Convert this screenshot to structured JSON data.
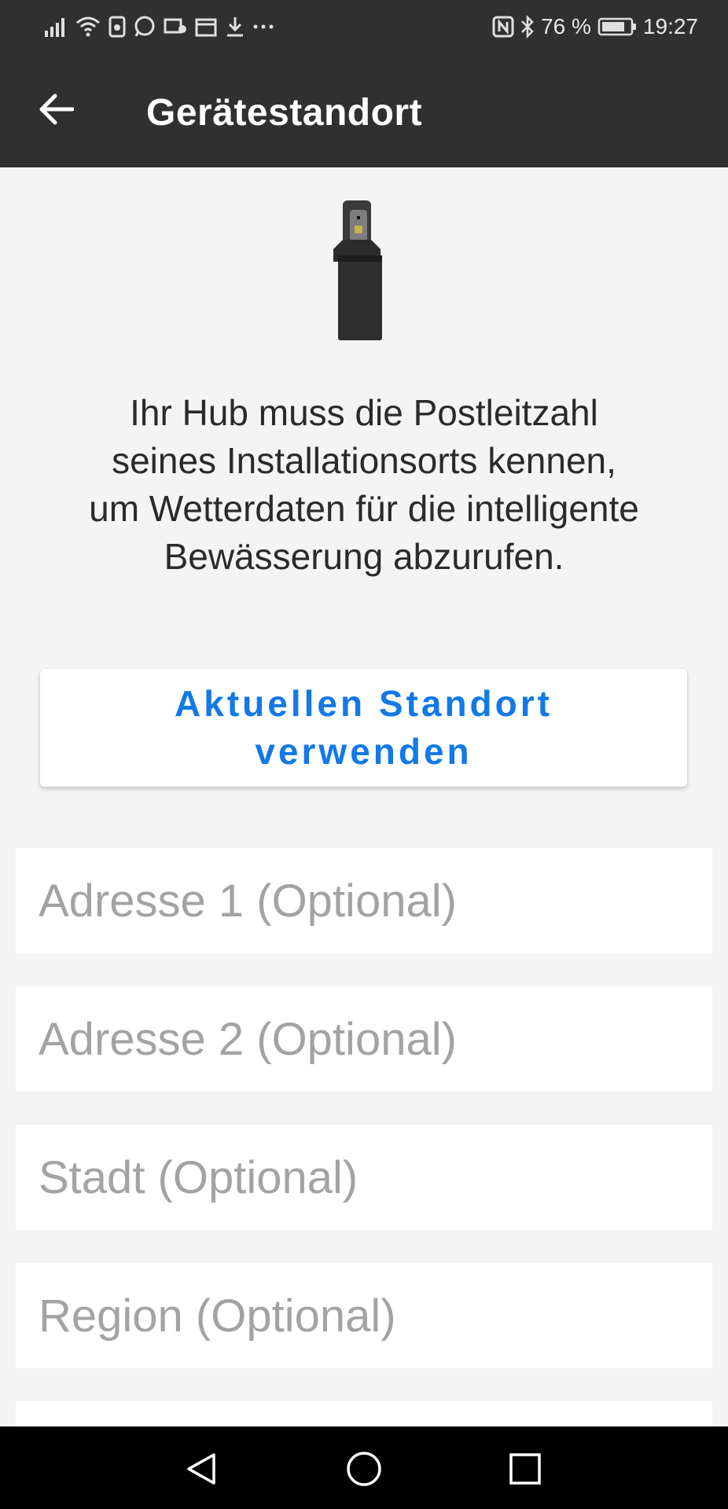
{
  "status_bar": {
    "battery_percent": "76 %",
    "time": "19:27",
    "left_icons": [
      "signal-icon",
      "wifi-icon",
      "sim-icon",
      "whatsapp-icon",
      "notification-icon",
      "calendar-icon",
      "download-icon",
      "more-icon"
    ],
    "right_icons": [
      "nfc-icon",
      "bluetooth-icon",
      "battery-icon"
    ]
  },
  "app_bar": {
    "title": "Gerätestandort"
  },
  "description": "Ihr Hub muss die Postleitzahl\nseines Installationsorts kennen,\num Wetterdaten für die intelligente\nBewässerung abzurufen.",
  "location_button": {
    "label": "Aktuellen Standort\nverwenden"
  },
  "fields": {
    "address1": {
      "placeholder": "Adresse 1 (Optional)",
      "value": ""
    },
    "address2": {
      "placeholder": "Adresse 2 (Optional)",
      "value": ""
    },
    "city": {
      "placeholder": "Stadt (Optional)",
      "value": ""
    },
    "region": {
      "placeholder": "Region (Optional)",
      "value": ""
    },
    "next": {
      "placeholder": "",
      "value": ""
    }
  },
  "colors": {
    "app_bar": "#303030",
    "accent": "#1279e6",
    "background": "#f4f4f4"
  }
}
